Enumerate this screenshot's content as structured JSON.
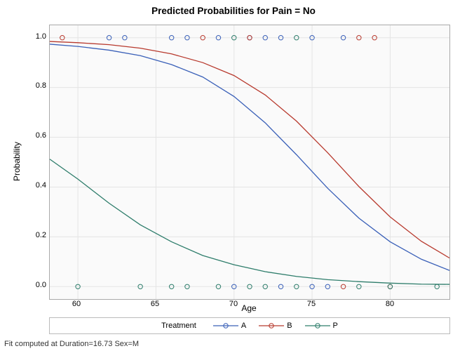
{
  "chart_data": {
    "type": "line",
    "title": "Predicted Probabilities for Pain = No",
    "xlabel": "Age",
    "ylabel": "Probability",
    "xlim": [
      58.2,
      83.8
    ],
    "ylim": [
      -0.05,
      1.05
    ],
    "x_ticks": [
      60,
      65,
      70,
      75,
      80
    ],
    "y_ticks": [
      0.0,
      0.2,
      0.4,
      0.6,
      0.8,
      1.0
    ],
    "legend_title": "Treatment",
    "series": [
      {
        "name": "A",
        "color": "#3a60b8",
        "x": [
          58.2,
          60,
          62,
          64,
          66,
          68,
          70,
          72,
          74,
          76,
          78,
          80,
          82,
          83.8
        ],
        "y": [
          0.974,
          0.965,
          0.95,
          0.928,
          0.892,
          0.842,
          0.764,
          0.658,
          0.53,
          0.395,
          0.275,
          0.18,
          0.11,
          0.065
        ],
        "scatter": [
          {
            "x": 62,
            "y": 1.0
          },
          {
            "x": 63,
            "y": 1.0
          },
          {
            "x": 66,
            "y": 1.0
          },
          {
            "x": 67,
            "y": 1.0
          },
          {
            "x": 69,
            "y": 1.0
          },
          {
            "x": 71,
            "y": 1.0
          },
          {
            "x": 72,
            "y": 1.0
          },
          {
            "x": 73,
            "y": 1.0
          },
          {
            "x": 75,
            "y": 1.0
          },
          {
            "x": 77,
            "y": 1.0
          },
          {
            "x": 70,
            "y": 0.0
          },
          {
            "x": 73,
            "y": 0.0
          },
          {
            "x": 75,
            "y": 0.0
          },
          {
            "x": 76,
            "y": 0.0
          }
        ]
      },
      {
        "name": "B",
        "color": "#b83a2e",
        "x": [
          58.2,
          60,
          62,
          64,
          66,
          68,
          70,
          72,
          74,
          76,
          78,
          80,
          82,
          83.8
        ],
        "y": [
          0.985,
          0.98,
          0.972,
          0.958,
          0.935,
          0.9,
          0.848,
          0.77,
          0.665,
          0.538,
          0.402,
          0.28,
          0.182,
          0.115
        ],
        "scatter": [
          {
            "x": 59,
            "y": 1.0
          },
          {
            "x": 68,
            "y": 1.0
          },
          {
            "x": 71,
            "y": 1.0
          },
          {
            "x": 78,
            "y": 1.0
          },
          {
            "x": 79,
            "y": 1.0
          },
          {
            "x": 77,
            "y": 0.0
          },
          {
            "x": 80,
            "y": 0.0
          }
        ]
      },
      {
        "name": "P",
        "color": "#2e7d6b",
        "x": [
          58.2,
          60,
          62,
          64,
          66,
          68,
          70,
          72,
          74,
          76,
          78,
          80,
          82,
          83.8
        ],
        "y": [
          0.512,
          0.432,
          0.335,
          0.248,
          0.18,
          0.125,
          0.088,
          0.06,
          0.041,
          0.028,
          0.02,
          0.014,
          0.01,
          0.009
        ],
        "scatter": [
          {
            "x": 70,
            "y": 1.0
          },
          {
            "x": 74,
            "y": 1.0
          },
          {
            "x": 60,
            "y": 0.0
          },
          {
            "x": 64,
            "y": 0.0
          },
          {
            "x": 66,
            "y": 0.0
          },
          {
            "x": 67,
            "y": 0.0
          },
          {
            "x": 69,
            "y": 0.0
          },
          {
            "x": 71,
            "y": 0.0
          },
          {
            "x": 72,
            "y": 0.0
          },
          {
            "x": 74,
            "y": 0.0
          },
          {
            "x": 78,
            "y": 0.0
          },
          {
            "x": 80,
            "y": 0.0
          },
          {
            "x": 83,
            "y": 0.0
          }
        ]
      }
    ],
    "footnote": "Fit computed at Duration=16.73 Sex=M"
  },
  "title": "Predicted Probabilities for Pain = No",
  "xlabel": "Age",
  "ylabel": "Probability",
  "legend_title": "Treatment",
  "legend": {
    "a": "A",
    "b": "B",
    "p": "P"
  },
  "footnote": "Fit computed at Duration=16.73 Sex=M",
  "xticks": {
    "t0": "60",
    "t1": "65",
    "t2": "70",
    "t3": "75",
    "t4": "80"
  },
  "yticks": {
    "t0": "0.0",
    "t1": "0.2",
    "t2": "0.4",
    "t3": "0.6",
    "t4": "0.8",
    "t5": "1.0"
  }
}
